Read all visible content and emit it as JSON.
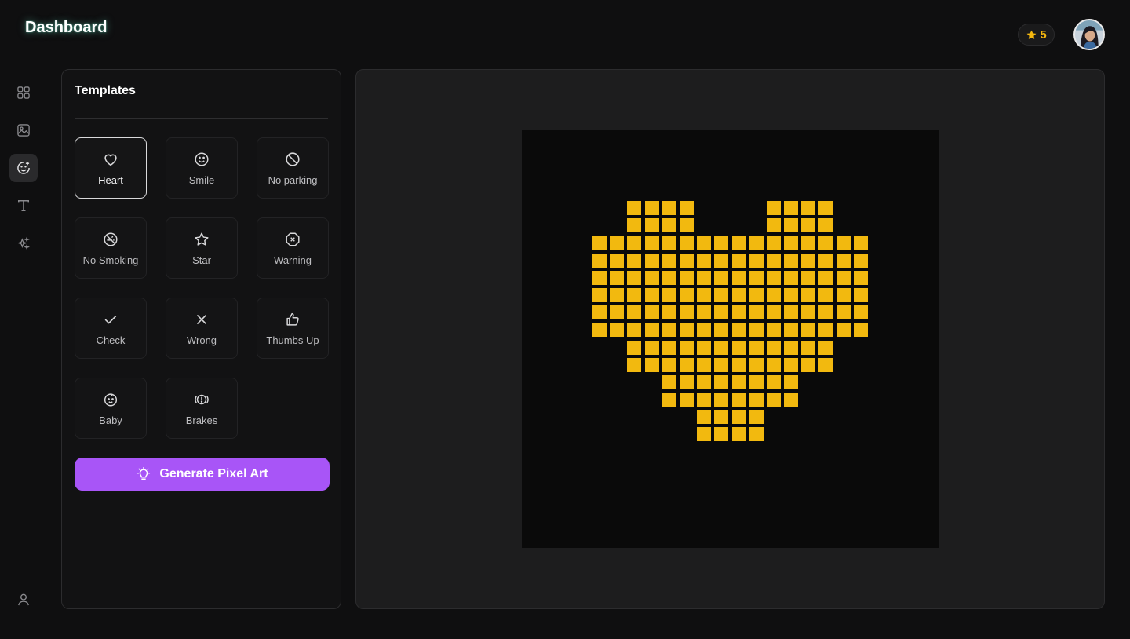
{
  "header": {
    "title": "Dashboard",
    "credits": "5",
    "star_color": "#f5b80f"
  },
  "rail": {
    "items": [
      {
        "icon": "grid-icon",
        "active": false
      },
      {
        "icon": "image-icon",
        "active": false
      },
      {
        "icon": "sticker-smile-icon",
        "active": true
      },
      {
        "icon": "text-icon",
        "active": false
      },
      {
        "icon": "sparkles-icon",
        "active": false
      }
    ],
    "bottom_icon": "user-icon"
  },
  "templates": {
    "title": "Templates",
    "selected": "Heart",
    "items": [
      {
        "label": "Heart",
        "icon": "heart-icon"
      },
      {
        "label": "Smile",
        "icon": "smile-icon"
      },
      {
        "label": "No parking",
        "icon": "no-parking-icon"
      },
      {
        "label": "No Smoking",
        "icon": "no-smoking-icon"
      },
      {
        "label": "Star",
        "icon": "star-icon"
      },
      {
        "label": "Warning",
        "icon": "warning-icon"
      },
      {
        "label": "Check",
        "icon": "check-icon"
      },
      {
        "label": "Wrong",
        "icon": "x-icon"
      },
      {
        "label": "Thumbs Up",
        "icon": "thumbs-up-icon"
      },
      {
        "label": "Baby",
        "icon": "baby-icon"
      },
      {
        "label": "Brakes",
        "icon": "brakes-icon"
      }
    ],
    "generate_label": "Generate Pixel Art",
    "accent_color": "#a855f7"
  },
  "pixel_art": {
    "cell_color": "#f2b90f",
    "columns": 16,
    "rows": [
      "..####....####..",
      "..####....####..",
      "################",
      "################",
      "################",
      "################",
      "################",
      "################",
      "..############..",
      "..############..",
      "....########....",
      "....########....",
      "......####......",
      "......####......"
    ]
  }
}
